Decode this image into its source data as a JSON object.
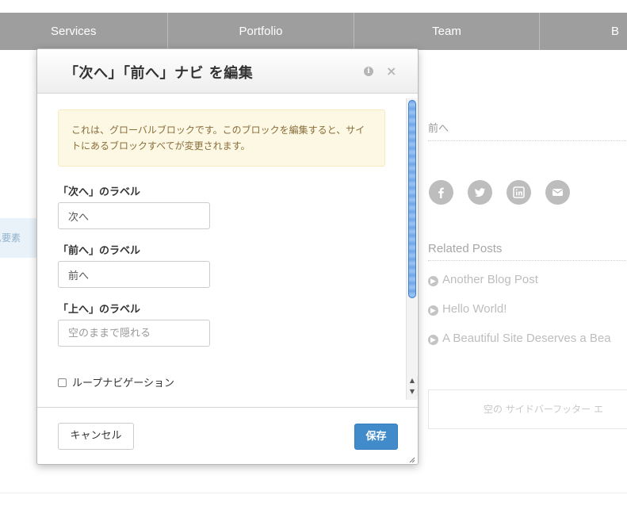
{
  "nav": {
    "items": [
      "Services",
      "Portfolio",
      "Team",
      "B"
    ]
  },
  "page": {
    "left_tab_label": "ム要素",
    "prev_link": "前へ",
    "social_icons": [
      "facebook-icon",
      "twitter-icon",
      "linkedin-icon",
      "email-icon"
    ],
    "related_title": "Related Posts",
    "related_posts": [
      "Another Blog Post",
      "Hello World!",
      "A Beautiful Site Deserves a Bea"
    ],
    "footer_area_text": "空の サイドバーフッター エ"
  },
  "dialog": {
    "title": "「次へ」「前へ」ナビ を編集",
    "alert": "これは、グローバルブロックです。このブロックを編集すると、サイトにあるブロックすべてが変更されます。",
    "next_label": "「次へ」のラベル",
    "next_value": "次へ",
    "prev_label": "「前へ」のラベル",
    "prev_value": "前へ",
    "up_label": "「上へ」のラベル",
    "up_placeholder": "空のままで隠れる",
    "loop_label": "ループナビゲーション",
    "cancel": "キャンセル",
    "save": "保存"
  },
  "colors": {
    "nav_bg": "#9e9e9e",
    "primary": "#428bca",
    "alert_bg": "#fcf8e3",
    "alert_text": "#8a6d3b"
  }
}
